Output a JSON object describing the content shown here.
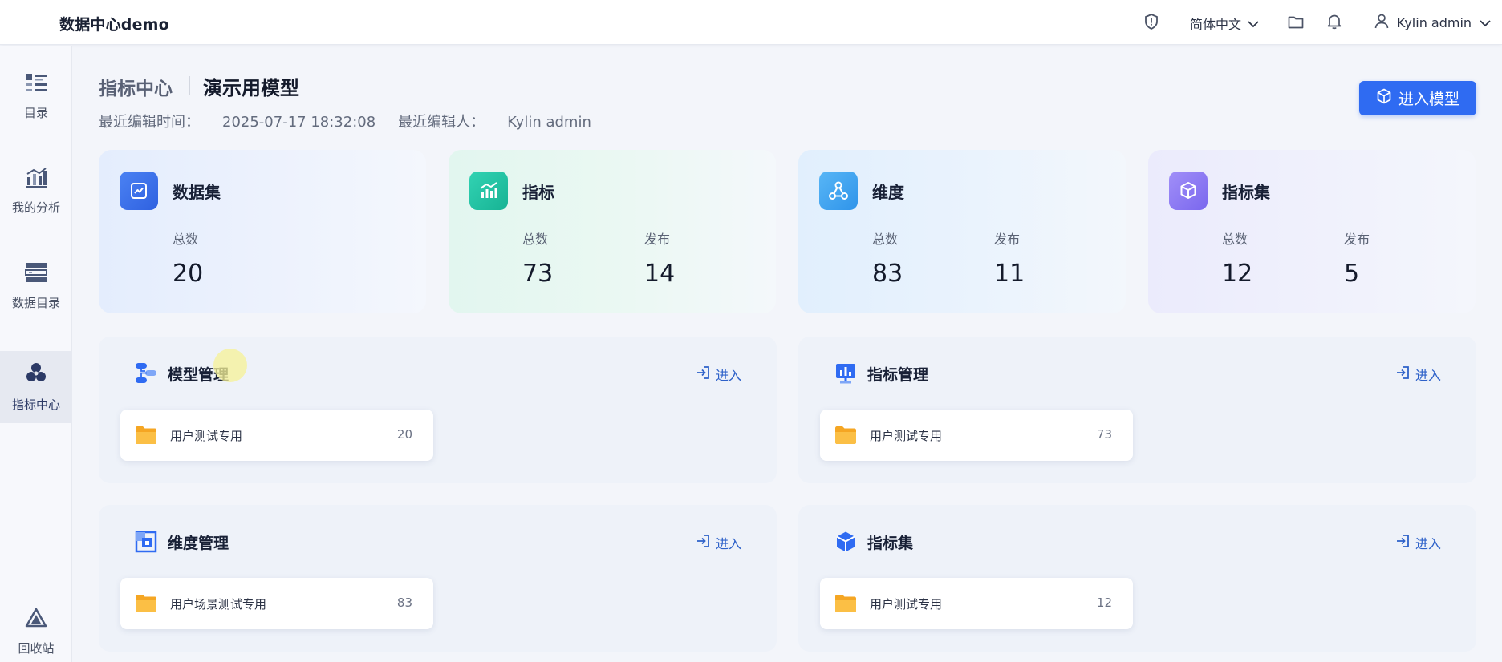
{
  "app": {
    "title": "数据中心demo"
  },
  "topbar": {
    "language": "简体中文",
    "username": "Kylin admin"
  },
  "sidebar": {
    "items": [
      {
        "label": "目录",
        "icon": "catalog-list-icon"
      },
      {
        "label": "我的分析",
        "icon": "analysis-chart-icon"
      },
      {
        "label": "数据目录",
        "icon": "data-catalog-icon"
      },
      {
        "label": "指标中心",
        "icon": "metrics-cube-icon",
        "active": true
      },
      {
        "label": "回收站",
        "icon": "recycle-bin-icon"
      }
    ]
  },
  "header": {
    "section": "指标中心",
    "model_name": "演示用模型",
    "edit_time_label": "最近编辑时间：",
    "edit_time": "2025-07-17 18:32:08",
    "editor_label": "最近编辑人：",
    "editor": "Kylin admin",
    "enter_model_label": "进入模型"
  },
  "stats": [
    {
      "name": "数据集",
      "total_label": "总数",
      "total": "20"
    },
    {
      "name": "指标",
      "total_label": "总数",
      "total": "73",
      "published_label": "发布",
      "published": "14"
    },
    {
      "name": "维度",
      "total_label": "总数",
      "total": "83",
      "published_label": "发布",
      "published": "11"
    },
    {
      "name": "指标集",
      "total_label": "总数",
      "total": "12",
      "published_label": "发布",
      "published": "5"
    }
  ],
  "panels": [
    {
      "title": "模型管理",
      "enter_label": "进入",
      "folder": {
        "name": "用户测试专用",
        "count": "20"
      }
    },
    {
      "title": "指标管理",
      "enter_label": "进入",
      "folder": {
        "name": "用户测试专用",
        "count": "73"
      }
    },
    {
      "title": "维度管理",
      "enter_label": "进入",
      "folder": {
        "name": "用户场景测试专用",
        "count": "83"
      }
    },
    {
      "title": "指标集",
      "enter_label": "进入",
      "folder": {
        "name": "用户测试专用",
        "count": "12"
      }
    }
  ],
  "colors": {
    "primary": "#2f6bf2",
    "link": "#2d61c9",
    "dataset_icon": "#3b6fe8",
    "metric_icon": "#22c3a4",
    "dimension_icon": "#3aa1f2",
    "metricset_icon": "#8b7cf6",
    "folder": "#f5a623"
  }
}
